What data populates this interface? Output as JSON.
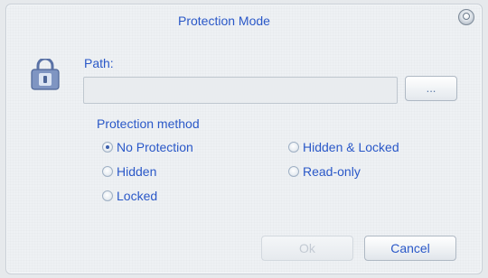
{
  "window": {
    "title": "Protection Mode",
    "close_icon": "close-circle-icon"
  },
  "path": {
    "label": "Path:",
    "value": "",
    "placeholder": "",
    "browse_label": "..."
  },
  "protection": {
    "group_label": "Protection method",
    "options": [
      {
        "label": "No Protection",
        "checked": true
      },
      {
        "label": "Hidden",
        "checked": false
      },
      {
        "label": "Locked",
        "checked": false
      },
      {
        "label": "Hidden & Locked",
        "checked": false
      },
      {
        "label": "Read-only",
        "checked": false
      }
    ]
  },
  "buttons": {
    "ok_label": "Ok",
    "ok_enabled": false,
    "cancel_label": "Cancel"
  },
  "icons": {
    "app_icon": "lock-icon"
  },
  "colors": {
    "accent_text": "#2a58c8",
    "disabled_text": "#c3cad3",
    "dialog_bg": "#eef1f4"
  }
}
